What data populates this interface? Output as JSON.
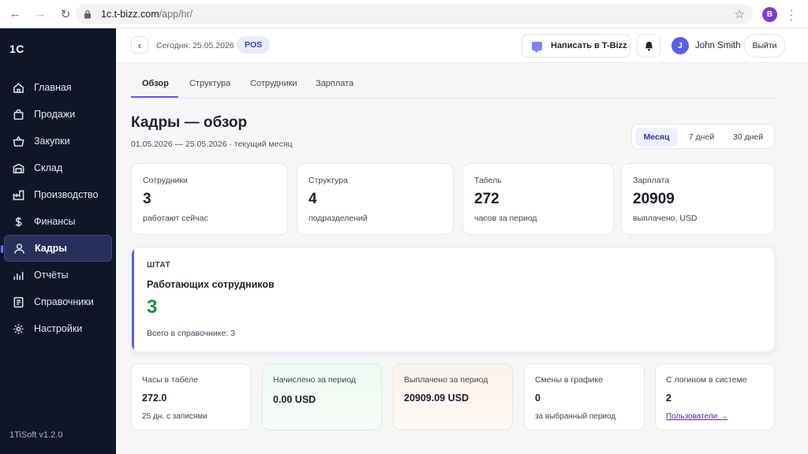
{
  "browser": {
    "url_host": "1c.t-bizz.com",
    "url_path": "/app/hr/",
    "profile_initial": "B"
  },
  "sidebar": {
    "logo": "1C",
    "items": [
      {
        "label": "Главная",
        "icon": "home-icon"
      },
      {
        "label": "Продажи",
        "icon": "shopping-bag-icon"
      },
      {
        "label": "Закупки",
        "icon": "basket-icon"
      },
      {
        "label": "Склад",
        "icon": "warehouse-icon"
      },
      {
        "label": "Производство",
        "icon": "factory-icon"
      },
      {
        "label": "Финансы",
        "icon": "dollar-icon"
      },
      {
        "label": "Кадры",
        "icon": "user-icon",
        "active": true
      },
      {
        "label": "Отчёты",
        "icon": "bar-chart-icon"
      },
      {
        "label": "Справочники",
        "icon": "book-icon"
      },
      {
        "label": "Настройки",
        "icon": "gear-icon"
      }
    ],
    "version": "1TiSoft v1.2.0"
  },
  "topbar": {
    "today": "Сегодня: 25.05.2026",
    "badge": "POS",
    "write_button": "Написать в T-Bizz",
    "avatar_initial": "J",
    "user_name": "John Smith",
    "logout": "Выйти"
  },
  "tabs": [
    "Обзор",
    "Структура",
    "Сотрудники",
    "Зарплата"
  ],
  "header": {
    "title": "Кадры — обзор",
    "date_range": "01.05.2026 — 25.05.2026",
    "period_note": "· текущий месяц",
    "periods": [
      "Месяц",
      "7 дней",
      "30 дней"
    ],
    "active_period": "Месяц"
  },
  "kpis": [
    {
      "label": "Сотрудники",
      "value": "3",
      "sub": "работают сейчас"
    },
    {
      "label": "Структура",
      "value": "4",
      "sub": "подразделений"
    },
    {
      "label": "Табель",
      "value": "272",
      "sub": "часов за период"
    },
    {
      "label": "Зарплата",
      "value": "20909",
      "sub": "выплачено, USD"
    }
  ],
  "staff": {
    "caps": "ШТАТ",
    "title": "Работающих сотрудников",
    "value": "3",
    "note": "Всего в справочнике: 3"
  },
  "bottom_cards": [
    {
      "label": "Часы в табеле",
      "value": "272.0",
      "sub": "25 дн. с записями"
    },
    {
      "label": "Начислено за период",
      "value": "0.00 USD",
      "sub": ""
    },
    {
      "label": "Выплачено за период",
      "value": "20909.09 USD",
      "sub": ""
    },
    {
      "label": "Смены в графике",
      "value": "0",
      "sub": "за выбранный период"
    },
    {
      "label": "С логином в системе",
      "value": "2",
      "link": "Пользователи →"
    }
  ],
  "colors": {
    "sidebar_bg": "#0f1629",
    "accent": "#5b5fe0",
    "positive": "#1f8a3d"
  }
}
